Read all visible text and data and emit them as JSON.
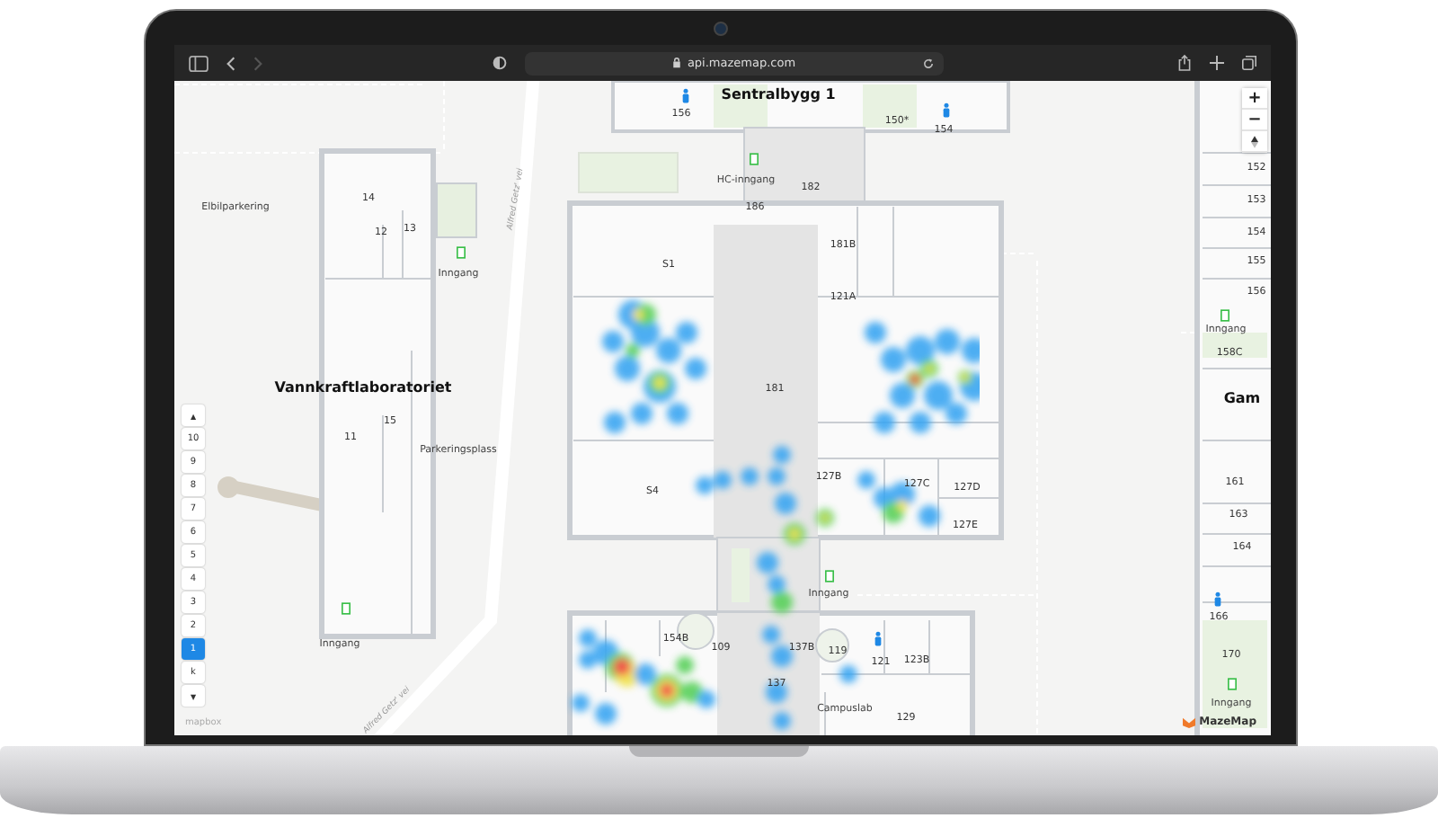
{
  "browser": {
    "url": "api.mazemap.com"
  },
  "map": {
    "labels": [
      {
        "text": "Sentralbygg 1",
        "kind": "building"
      },
      {
        "text": "156",
        "kind": "room"
      },
      {
        "text": "150*",
        "kind": "room"
      },
      {
        "text": "154",
        "kind": "room"
      },
      {
        "text": "152",
        "kind": "room"
      },
      {
        "text": "153",
        "kind": "room"
      },
      {
        "text": "154",
        "kind": "room"
      },
      {
        "text": "155",
        "kind": "room"
      },
      {
        "text": "156",
        "kind": "room"
      },
      {
        "text": "HC-inngang",
        "kind": "place"
      },
      {
        "text": "182",
        "kind": "room"
      },
      {
        "text": "186",
        "kind": "room"
      },
      {
        "text": "14",
        "kind": "room"
      },
      {
        "text": "Elbilparkering",
        "kind": "place"
      },
      {
        "text": "12",
        "kind": "room"
      },
      {
        "text": "13",
        "kind": "room"
      },
      {
        "text": "Inngang",
        "kind": "place"
      },
      {
        "text": "181B",
        "kind": "room"
      },
      {
        "text": "S1",
        "kind": "room"
      },
      {
        "text": "121A",
        "kind": "room"
      },
      {
        "text": "Inngang",
        "kind": "place"
      },
      {
        "text": "158C",
        "kind": "room"
      },
      {
        "text": "Gam",
        "kind": "building"
      },
      {
        "text": "Vannkraftlaboratoriet",
        "kind": "building"
      },
      {
        "text": "181",
        "kind": "room"
      },
      {
        "text": "11",
        "kind": "room"
      },
      {
        "text": "15",
        "kind": "room"
      },
      {
        "text": "Parkeringsplass",
        "kind": "place"
      },
      {
        "text": "161",
        "kind": "room"
      },
      {
        "text": "127B",
        "kind": "room"
      },
      {
        "text": "127C",
        "kind": "room"
      },
      {
        "text": "127D",
        "kind": "room"
      },
      {
        "text": "S4",
        "kind": "room"
      },
      {
        "text": "163",
        "kind": "room"
      },
      {
        "text": "127E",
        "kind": "room"
      },
      {
        "text": "164",
        "kind": "room"
      },
      {
        "text": "Inngang",
        "kind": "place"
      },
      {
        "text": "166",
        "kind": "room"
      },
      {
        "text": "154B",
        "kind": "room"
      },
      {
        "text": "109",
        "kind": "room"
      },
      {
        "text": "137B",
        "kind": "room"
      },
      {
        "text": "119",
        "kind": "room"
      },
      {
        "text": "121",
        "kind": "room"
      },
      {
        "text": "123B",
        "kind": "room"
      },
      {
        "text": "170",
        "kind": "room"
      },
      {
        "text": "Inngang",
        "kind": "place"
      },
      {
        "text": "137",
        "kind": "room"
      },
      {
        "text": "Campuslab",
        "kind": "place"
      },
      {
        "text": "129",
        "kind": "room"
      },
      {
        "text": "Inngang",
        "kind": "place"
      }
    ],
    "streets": [
      {
        "text": "Alfred Getz' vei"
      },
      {
        "text": "Alfred Getz' vei"
      }
    ],
    "floor_selector": {
      "up": "▲",
      "down": "▼",
      "floors": [
        {
          "label": "10",
          "selected": false
        },
        {
          "label": "9",
          "selected": false
        },
        {
          "label": "8",
          "selected": false
        },
        {
          "label": "7",
          "selected": false
        },
        {
          "label": "6",
          "selected": false
        },
        {
          "label": "5",
          "selected": false
        },
        {
          "label": "4",
          "selected": false
        },
        {
          "label": "3",
          "selected": false
        },
        {
          "label": "2",
          "selected": false
        },
        {
          "label": "1",
          "selected": true
        },
        {
          "label": "k",
          "selected": false
        }
      ]
    },
    "zoom": {
      "in": "+",
      "out": "−"
    },
    "attribution": {
      "mapbox": "mapbox",
      "logo": "MazeMap"
    }
  }
}
